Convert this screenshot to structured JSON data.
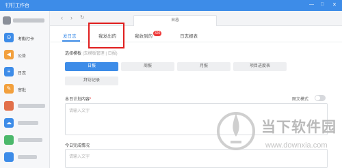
{
  "window": {
    "title": "钉钉工作台",
    "minimize_glyph": "—",
    "maximize_glyph": "□",
    "close_glyph": "✕"
  },
  "sidebar": {
    "items": [
      {
        "label": "考勤打卡",
        "icon": "location-pin-icon",
        "icon_glyph": "⊙",
        "color": "#3d8ce8"
      },
      {
        "label": "公告",
        "icon": "megaphone-icon",
        "icon_glyph": "◀",
        "color": "#f2a03d"
      },
      {
        "label": "日志",
        "icon": "log-icon",
        "icon_glyph": "≡",
        "color": "#3d8ce8"
      },
      {
        "label": "审批",
        "icon": "approval-icon",
        "icon_glyph": "✎",
        "color": "#f2a03d"
      },
      {
        "label": "",
        "icon": "app-icon",
        "icon_glyph": "",
        "color": "#e2704a"
      },
      {
        "label": "",
        "icon": "cloud-icon",
        "icon_glyph": "☁",
        "color": "#3d8ce8"
      },
      {
        "label": "",
        "icon": "app-icon",
        "icon_glyph": "",
        "color": "#4bb86b"
      },
      {
        "label": "",
        "icon": "app-icon",
        "icon_glyph": "",
        "color": "#3d8ce8"
      }
    ]
  },
  "nav": {
    "back_glyph": "‹",
    "forward_glyph": "›",
    "refresh_glyph": "↻",
    "tab_label": "日志"
  },
  "subtabs": [
    {
      "label": "发日志",
      "active": true
    },
    {
      "label": "我发出的",
      "active": false
    },
    {
      "label": "我收到的",
      "active": false,
      "badge": "320"
    },
    {
      "label": "日志报表",
      "active": false
    }
  ],
  "template": {
    "label": "选择模板",
    "hint": "(去模板管理 | 日报)",
    "buttons": [
      "日报",
      "周报",
      "月报",
      "项目进度表",
      "拜访记录"
    ]
  },
  "fields": [
    {
      "label": "本日计划内容",
      "required": true,
      "placeholder": "请输入文字"
    },
    {
      "label": "今日完成情况",
      "required": false,
      "placeholder": "请输入文字"
    }
  ],
  "toggle": {
    "label": "图文模式",
    "on": false
  },
  "watermark": {
    "title": "当下软件园",
    "url": "www.downxia.com"
  },
  "colors": {
    "accent": "#3d8ce8",
    "highlight": "#e01d1d",
    "badge": "#ee3636"
  }
}
